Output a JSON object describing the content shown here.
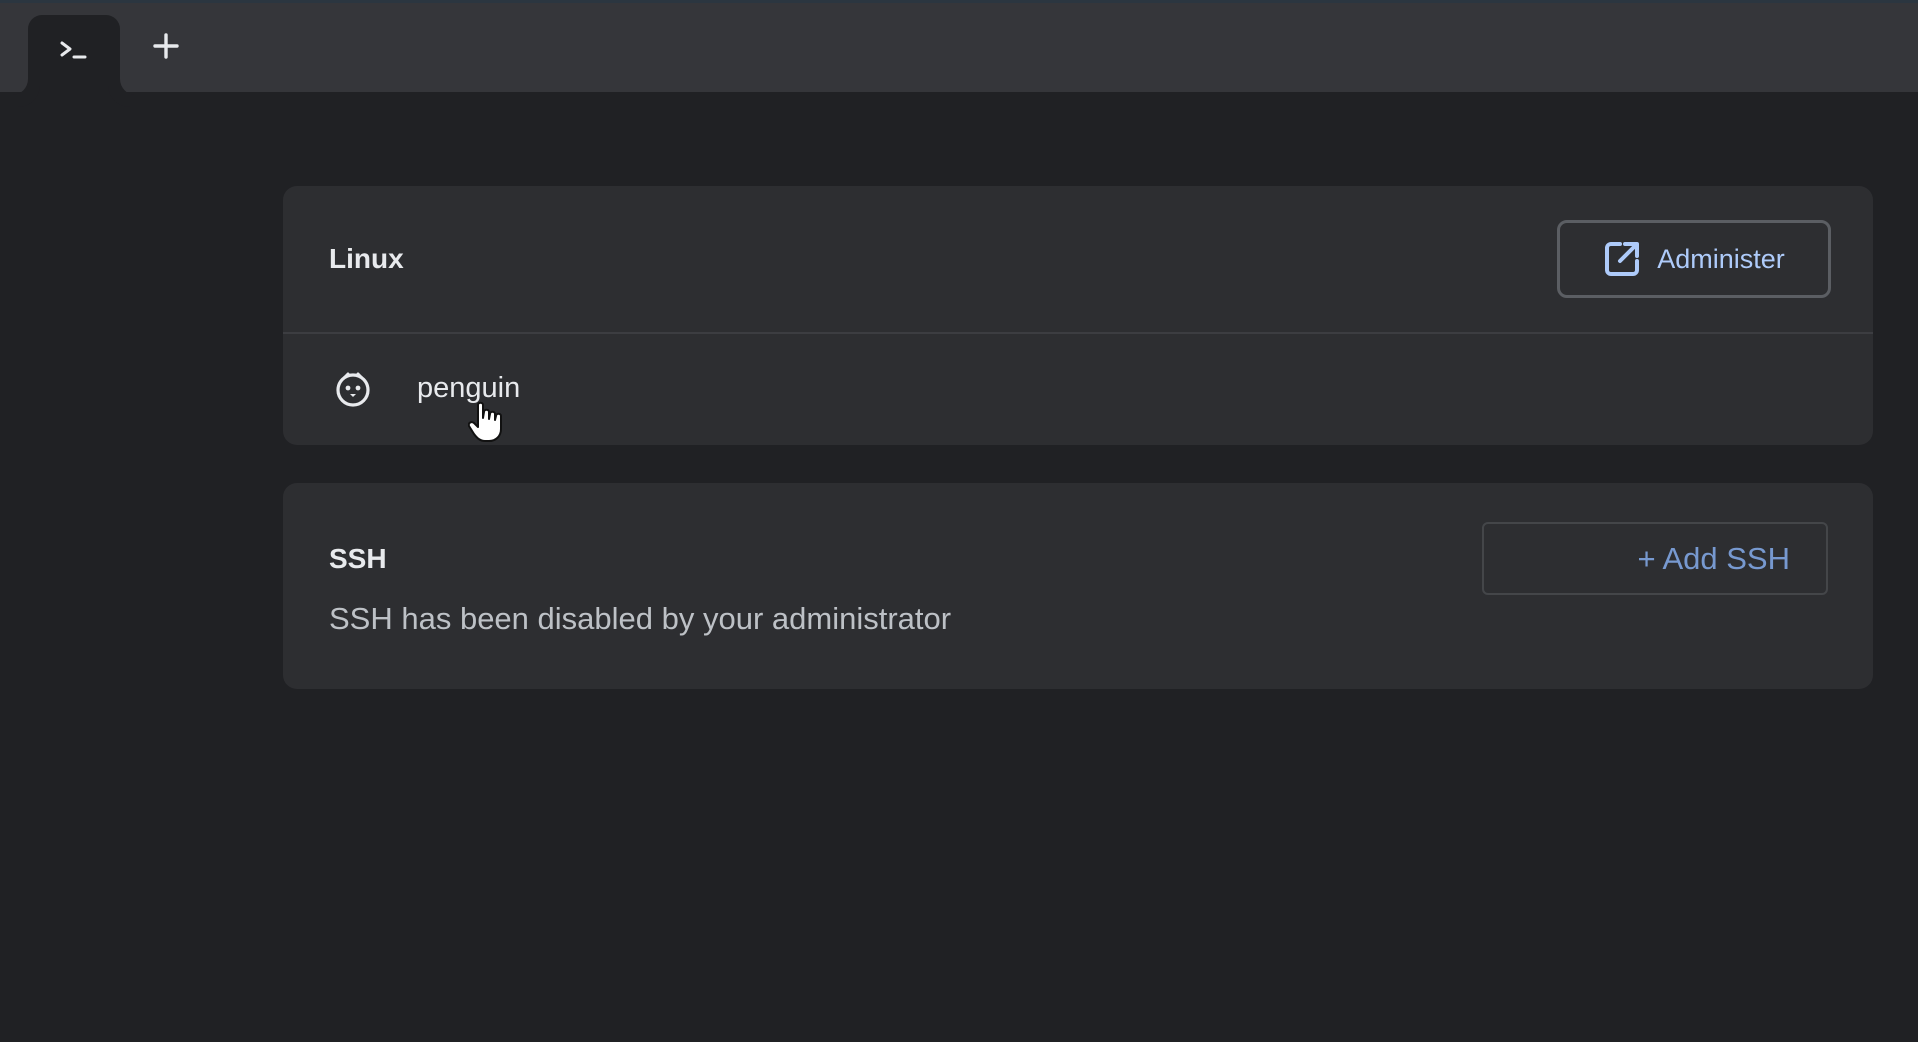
{
  "tabs": {
    "active_tab_icon": "terminal-prompt-icon",
    "new_tab_icon": "plus-icon"
  },
  "linux": {
    "title": "Linux",
    "administer_label": "Administer",
    "administer_icon": "open-in-new-icon",
    "containers": [
      {
        "name": "penguin",
        "icon": "penguin-icon"
      }
    ]
  },
  "ssh": {
    "title": "SSH",
    "add_label": "+ Add SSH",
    "message": "SSH has been disabled by your administrator"
  },
  "colors": {
    "background": "#202124",
    "tabstrip": "#35363a",
    "card": "#2d2e31",
    "accent": "#8ab4f8"
  }
}
